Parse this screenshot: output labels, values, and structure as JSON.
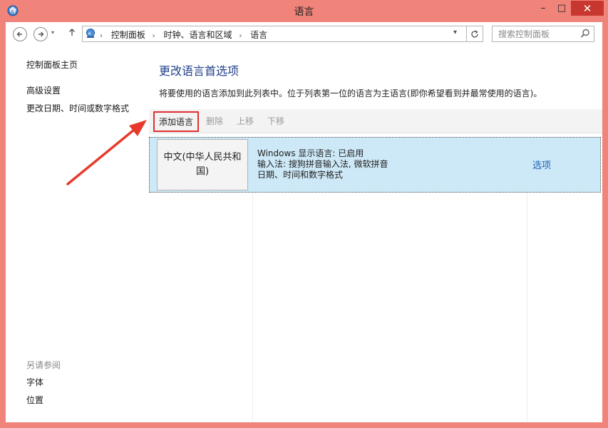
{
  "window": {
    "title": "语言",
    "minimize_symbol": "–",
    "maximize_symbol": "□",
    "close_symbol": "✕"
  },
  "address": {
    "crumbs": [
      "控制面板",
      "时钟、语言和区域",
      "语言"
    ],
    "separator": "›",
    "search_placeholder": "搜索控制面板"
  },
  "sidebar": {
    "home": "控制面板主页",
    "links": [
      "高级设置",
      "更改日期、时间或数字格式"
    ],
    "see_also_heading": "另请参阅",
    "see_also": [
      "字体",
      "位置"
    ]
  },
  "main": {
    "title": "更改语言首选项",
    "description": "将要使用的语言添加到此列表中。位于列表第一位的语言为主语言(即你希望看到并最常使用的语言)。",
    "toolbar": {
      "add": "添加语言",
      "remove": "删除",
      "move_up": "上移",
      "move_down": "下移"
    },
    "languages": [
      {
        "name": "中文(中华人民共和国)",
        "display_lang": "Windows 显示语言: 已启用",
        "input_methods": "输入法: 搜狗拼音输入法, 微软拼音",
        "formats": "日期、时间和数字格式",
        "options_link": "选项"
      }
    ]
  },
  "colors": {
    "frame": "#f0837a",
    "close": "#c7372f",
    "title_blue": "#1e3f8a",
    "row_selected": "#cde8f6",
    "highlight_red": "#e03030"
  },
  "icons": [
    "app-language-icon",
    "back-arrow-icon",
    "forward-arrow-icon",
    "up-arrow-icon",
    "control-panel-icon",
    "refresh-icon",
    "search-icon",
    "red-arrow-annotation"
  ]
}
